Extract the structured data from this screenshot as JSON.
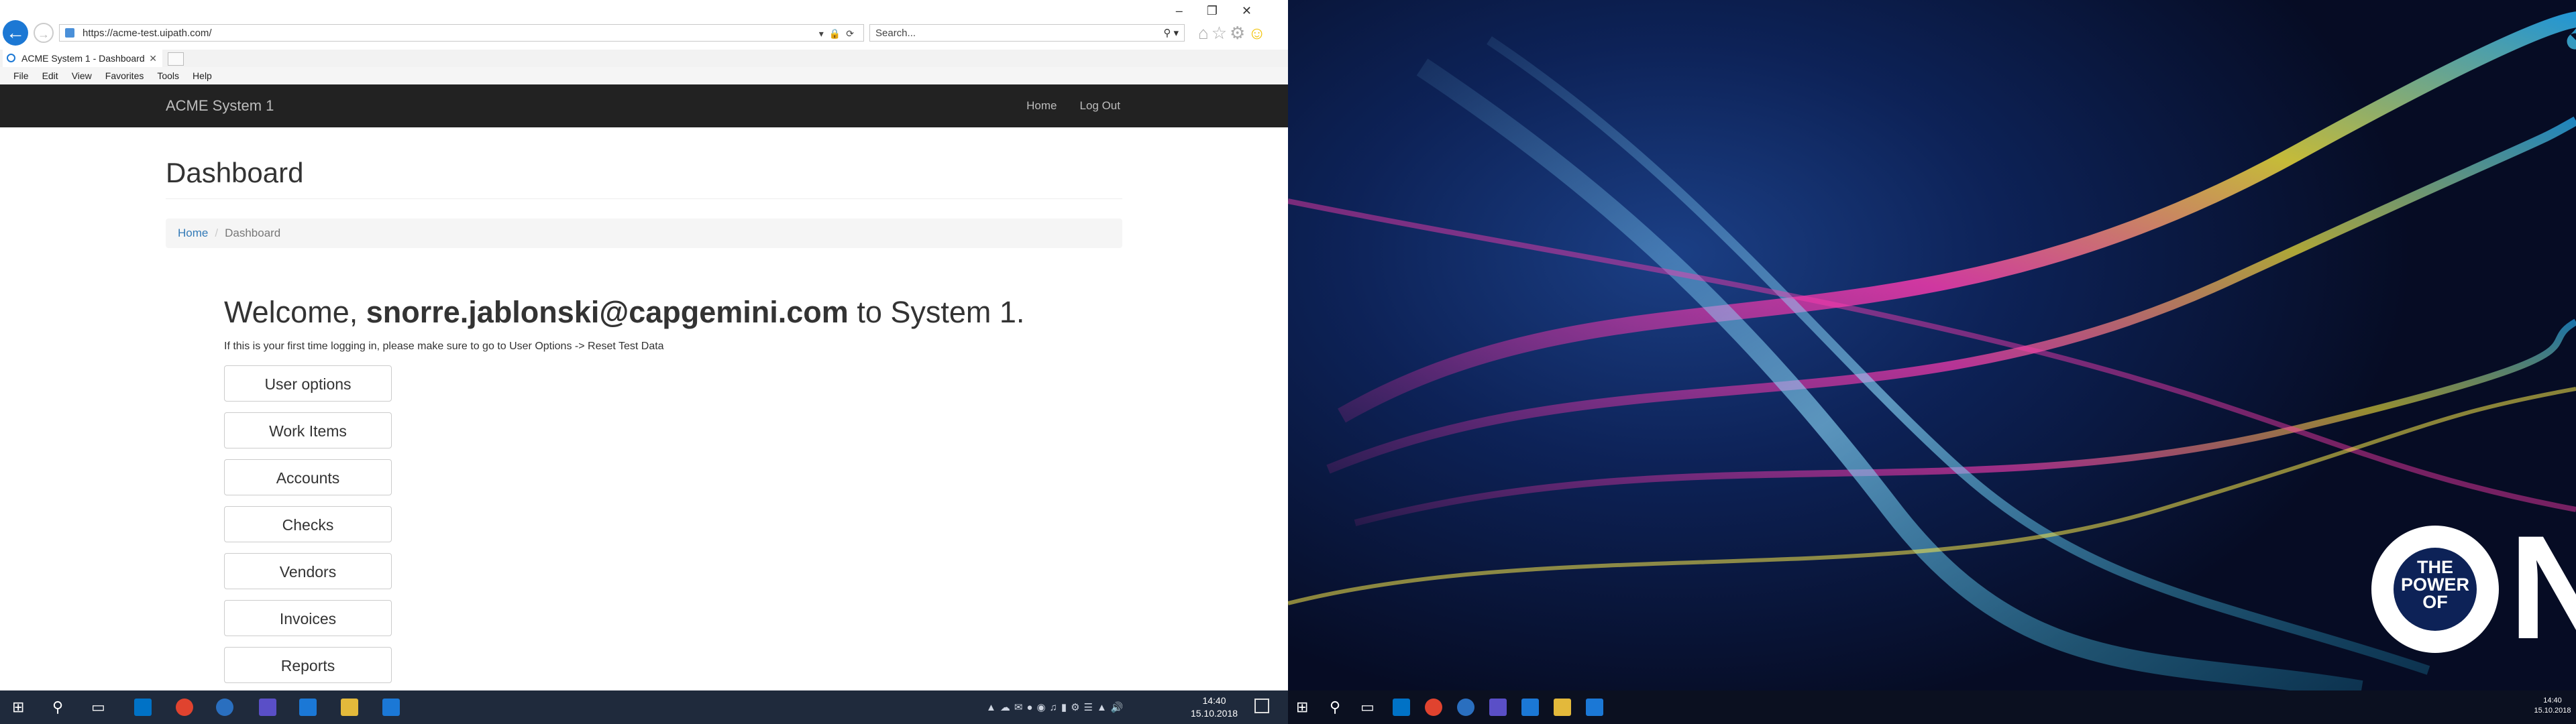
{
  "browser": {
    "url": "https://acme-test.uipath.com/",
    "search_placeholder": "Search...",
    "tab_title": "ACME System 1 - Dashboard",
    "menu": [
      "File",
      "Edit",
      "View",
      "Favorites",
      "Tools",
      "Help"
    ]
  },
  "acme": {
    "brand": "ACME System 1",
    "nav": {
      "home": "Home",
      "logout": "Log Out"
    },
    "page_title": "Dashboard",
    "breadcrumb": {
      "home": "Home",
      "separator": "/",
      "current": "Dashboard"
    },
    "welcome": {
      "prefix": "Welcome, ",
      "user": "snorre.jablonski@capgemini.com",
      "suffix": " to System 1."
    },
    "hint": "If this is your first time logging in, please make sure to go to User Options -> Reset Test Data",
    "buttons": [
      "User options",
      "Work Items",
      "Accounts",
      "Checks",
      "Vendors",
      "Invoices",
      "Reports"
    ]
  },
  "taskbar": {
    "time": "14:40",
    "date": "15.10.2018"
  },
  "wallpaper": {
    "the": "THE",
    "power": "POWER",
    "of": "OF",
    "one": "NE"
  }
}
